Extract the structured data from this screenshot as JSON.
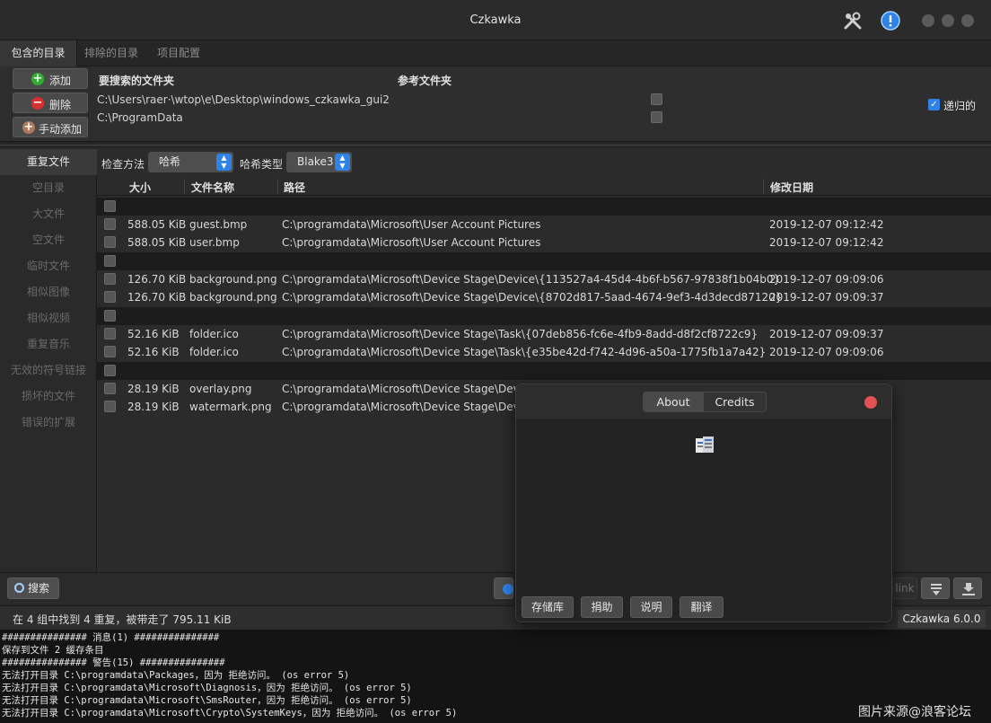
{
  "window": {
    "title": "Czkawka"
  },
  "top_tabs": [
    "包含的目录",
    "排除的目录",
    "项目配置"
  ],
  "dir_panel": {
    "buttons": {
      "add": "添加",
      "remove": "删除",
      "manual_add": "手动添加"
    },
    "headers": {
      "search_folders": "要搜索的文件夹",
      "reference_folders": "参考文件夹"
    },
    "paths": [
      "C:\\Users\\raer·\\wtop\\e\\Desktop\\windows_czkawka_gui2",
      "C:\\ProgramData"
    ],
    "recursive_label": "递归的"
  },
  "sidebar": {
    "items": [
      "重复文件",
      "空目录",
      "大文件",
      "空文件",
      "临时文件",
      "相似图像",
      "相似视频",
      "重复音乐",
      "无效的符号链接",
      "损坏的文件",
      "错误的扩展"
    ]
  },
  "options": {
    "check_method_label": "检查方法",
    "check_method_value": "哈希",
    "hash_type_label": "哈希类型",
    "hash_type_value": "Blake3"
  },
  "table": {
    "headers": {
      "size": "大小",
      "name": "文件名称",
      "path": "路径",
      "modified": "修改日期"
    },
    "rows": [
      {
        "group": true
      },
      {
        "size": "588.05 KiB",
        "name": "guest.bmp",
        "path": "C:\\programdata\\Microsoft\\User Account Pictures",
        "modified": "2019-12-07 09:12:42"
      },
      {
        "size": "588.05 KiB",
        "name": "user.bmp",
        "path": "C:\\programdata\\Microsoft\\User Account Pictures",
        "modified": "2019-12-07 09:12:42"
      },
      {
        "group": true
      },
      {
        "size": "126.70 KiB",
        "name": "background.png",
        "path": "C:\\programdata\\Microsoft\\Device Stage\\Device\\{113527a4-45d4-4b6f-b567-97838f1b04b0}",
        "modified": "2019-12-07 09:09:06"
      },
      {
        "size": "126.70 KiB",
        "name": "background.png",
        "path": "C:\\programdata\\Microsoft\\Device Stage\\Device\\{8702d817-5aad-4674-9ef3-4d3decd87120}",
        "modified": "2019-12-07 09:09:37"
      },
      {
        "group": true
      },
      {
        "size": "52.16 KiB",
        "name": "folder.ico",
        "path": "C:\\programdata\\Microsoft\\Device Stage\\Task\\{07deb856-fc6e-4fb9-8add-d8f2cf8722c9}",
        "modified": "2019-12-07 09:09:37"
      },
      {
        "size": "52.16 KiB",
        "name": "folder.ico",
        "path": "C:\\programdata\\Microsoft\\Device Stage\\Task\\{e35be42d-f742-4d96-a50a-1775fb1a7a42}",
        "modified": "2019-12-07 09:09:06"
      },
      {
        "group": true
      },
      {
        "size": "28.19 KiB",
        "name": "overlay.png",
        "path": "C:\\programdata\\Microsoft\\Device Stage\\Device",
        "modified": ""
      },
      {
        "size": "28.19 KiB",
        "name": "watermark.png",
        "path": "C:\\programdata\\Microsoft\\Device Stage\\Device",
        "modified": ""
      }
    ]
  },
  "action_bar": {
    "search_label": "搜索",
    "partial_link_text": "link"
  },
  "status": {
    "summary": "在 4 组中找到 4 重复，被带走了 795.11 KiB",
    "version": "Czkawka 6.0.0"
  },
  "log_lines": [
    "############### 消息(1) ###############",
    "保存到文件 2 缓存条目",
    "############### 警告(15) ###############",
    "无法打开目录 C:\\programdata\\Packages，因为 拒绝访问。 (os error 5)",
    "无法打开目录 C:\\programdata\\Microsoft\\Diagnosis，因为 拒绝访问。 (os error 5)",
    "无法打开目录 C:\\programdata\\Microsoft\\SmsRouter，因为 拒绝访问。 (os error 5)",
    "无法打开目录 C:\\programdata\\Microsoft\\Crypto\\SystemKeys，因为 拒绝访问。 (os error 5)"
  ],
  "watermark": "图片来源@浪客论坛",
  "about_dialog": {
    "tabs": [
      "About",
      "Credits"
    ],
    "buttons": [
      "存储库",
      "捐助",
      "说明",
      "翻译"
    ]
  },
  "colors": {
    "accent": "#2f82e8",
    "close": "#e25252",
    "group_row": "#1c1c1c"
  }
}
